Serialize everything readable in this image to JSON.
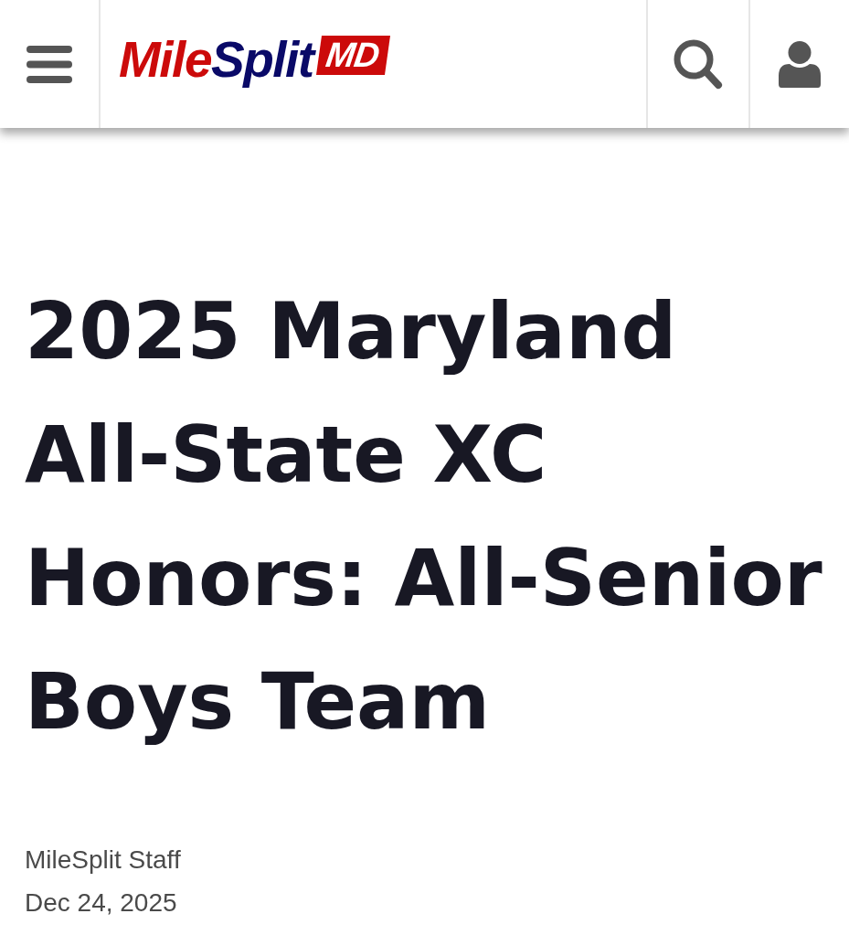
{
  "header": {
    "logo": {
      "first": "Mile",
      "second": "Split",
      "badge": "MD"
    }
  },
  "article": {
    "title": "2025 Maryland All-State XC Honors: All-Senior Boys Team",
    "author": "MileSplit Staff",
    "date": "Dec 24, 2025"
  }
}
